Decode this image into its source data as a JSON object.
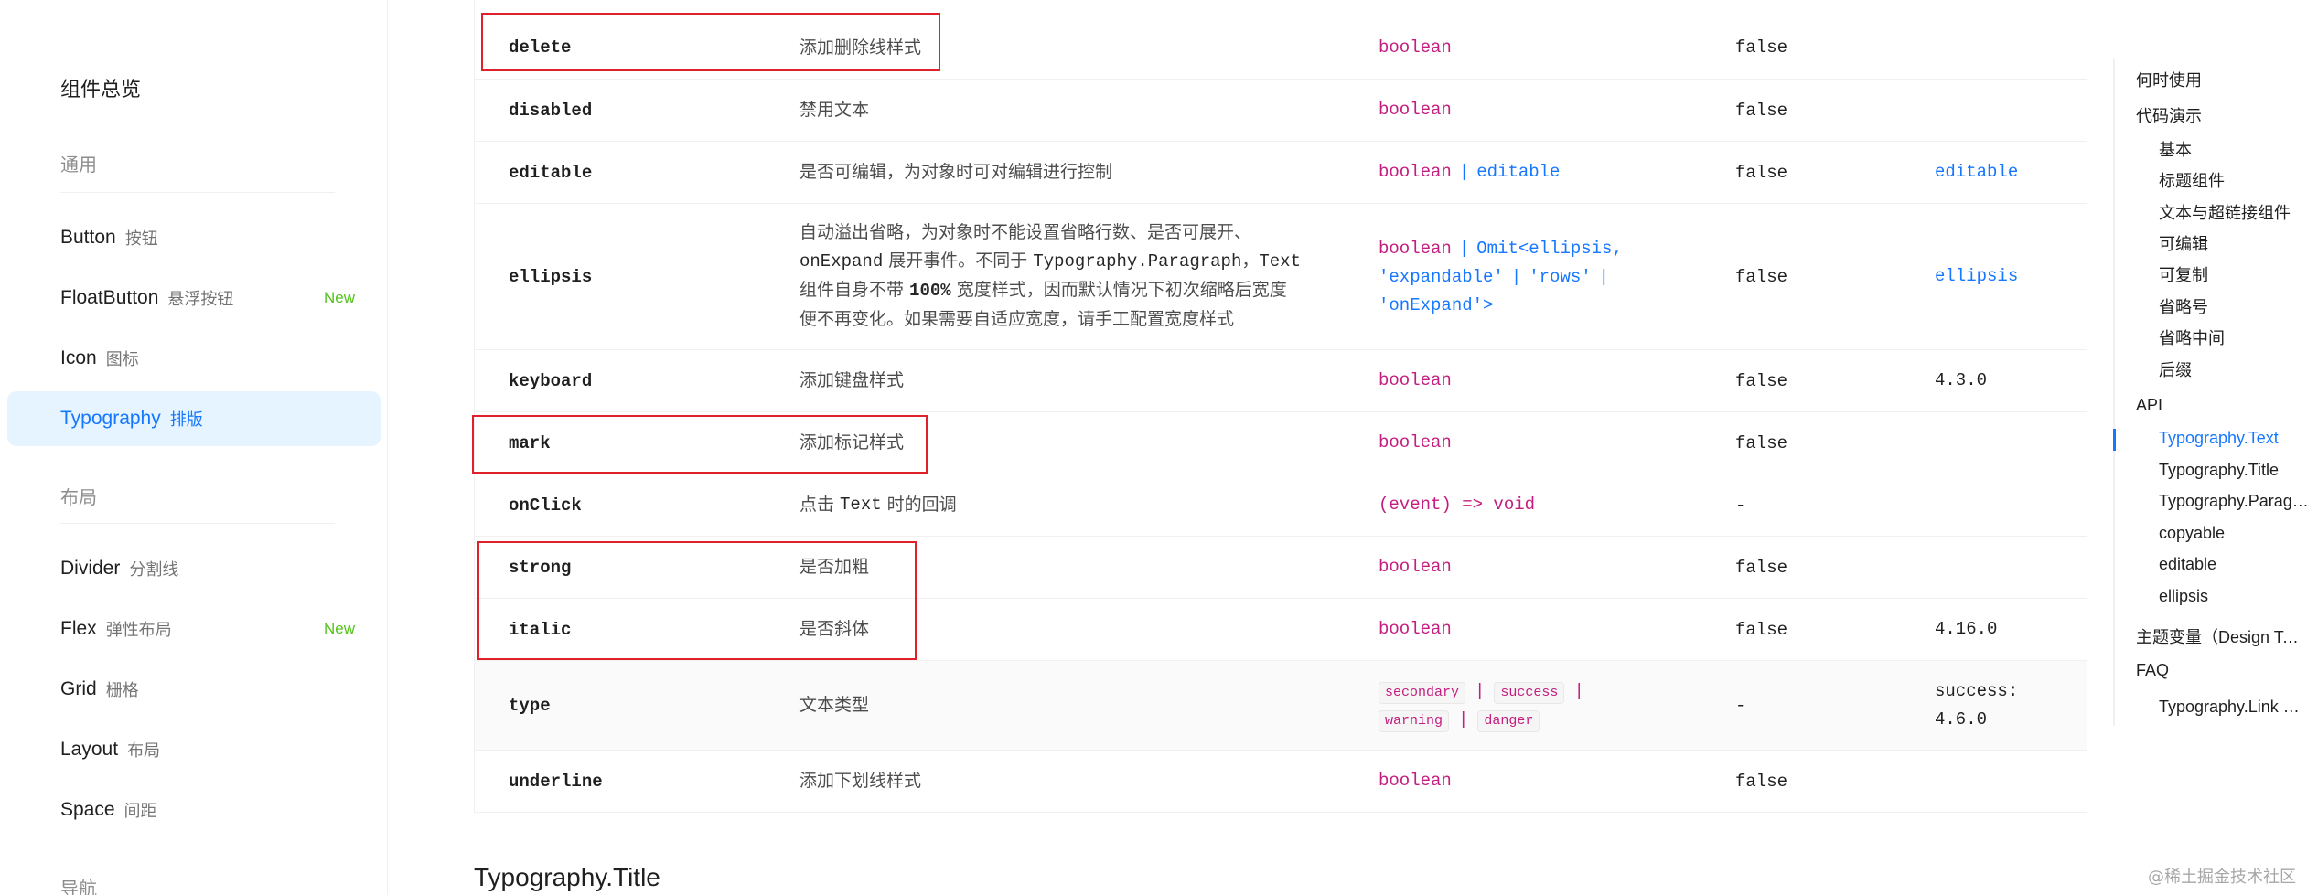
{
  "sidebar": {
    "title": "组件总览",
    "groups": {
      "general": "通用",
      "layout": "布局",
      "nav": "导航"
    },
    "items": [
      {
        "en": "Button",
        "cn": "按钮",
        "badge": ""
      },
      {
        "en": "FloatButton",
        "cn": "悬浮按钮",
        "badge": "New"
      },
      {
        "en": "Icon",
        "cn": "图标",
        "badge": ""
      },
      {
        "en": "Typography",
        "cn": "排版",
        "badge": ""
      },
      {
        "en": "Divider",
        "cn": "分割线",
        "badge": ""
      },
      {
        "en": "Flex",
        "cn": "弹性布局",
        "badge": "New"
      },
      {
        "en": "Grid",
        "cn": "栅格",
        "badge": ""
      },
      {
        "en": "Layout",
        "cn": "布局",
        "badge": ""
      },
      {
        "en": "Space",
        "cn": "间距",
        "badge": ""
      }
    ]
  },
  "table": {
    "rows": {
      "delete": {
        "prop": "delete",
        "desc": "添加删除线样式",
        "type": "boolean",
        "def": "false",
        "ver": ""
      },
      "disabled": {
        "prop": "disabled",
        "desc": "禁用文本",
        "type": "boolean",
        "def": "false",
        "ver": ""
      },
      "editable": {
        "prop": "editable",
        "desc": "是否可编辑，为对象时可对编辑进行控制",
        "type_a": "boolean",
        "type_sep": "|",
        "type_b": "editable",
        "def": "false",
        "ver": "editable"
      },
      "ellipsis": {
        "prop": "ellipsis",
        "desc_1": "自动溢出省略，为对象时不能设置省略行数、是否可展开、",
        "desc_2a": "onExpand",
        "desc_2b": " 展开事件。不同于 ",
        "desc_2c": "Typography.Paragraph",
        "desc_2d": "，",
        "desc_2e": "Text",
        "desc_3a": "组件自身不带 ",
        "desc_3b": "100%",
        "desc_3c": " 宽度样式，因而默认情况下初次缩略后宽度",
        "desc_4": "便不再变化。如果需要自适应宽度，请手工配置宽度样式",
        "type_1a": "boolean",
        "type_1sep": "|",
        "type_1b": "Omit<ellipsis,",
        "type_2a": "'expandable'",
        "type_2sep1": "|",
        "type_2b": "'rows'",
        "type_2sep2": "|",
        "type_3": "'onExpand'>",
        "def": "false",
        "ver": "ellipsis"
      },
      "keyboard": {
        "prop": "keyboard",
        "desc": "添加键盘样式",
        "type": "boolean",
        "def": "false",
        "ver": "4.3.0"
      },
      "mark": {
        "prop": "mark",
        "desc": "添加标记样式",
        "type": "boolean",
        "def": "false",
        "ver": ""
      },
      "onClick": {
        "prop": "onClick",
        "desc_a": "点击 ",
        "desc_b": "Text",
        "desc_c": " 时的回调",
        "type": "(event) => void",
        "def": "-",
        "ver": ""
      },
      "strong": {
        "prop": "strong",
        "desc": "是否加粗",
        "type": "boolean",
        "def": "false",
        "ver": ""
      },
      "italic": {
        "prop": "italic",
        "desc": "是否斜体",
        "type": "boolean",
        "def": "false",
        "ver": "4.16.0"
      },
      "type": {
        "prop": "type",
        "desc": "文本类型",
        "tags": [
          "secondary",
          "success",
          "warning",
          "danger"
        ],
        "sep": "|",
        "def": "-",
        "ver_1": "success:",
        "ver_2": "4.6.0"
      },
      "underline": {
        "prop": "underline",
        "desc": "添加下划线样式",
        "type": "boolean",
        "def": "false",
        "ver": ""
      }
    }
  },
  "section_title": "Typography.Title",
  "anchor": {
    "items": [
      {
        "label": "何时使用",
        "level": 1
      },
      {
        "label": "代码演示",
        "level": 1
      },
      {
        "label": "基本",
        "level": 2
      },
      {
        "label": "标题组件",
        "level": 2
      },
      {
        "label": "文本与超链接组件",
        "level": 2
      },
      {
        "label": "可编辑",
        "level": 2
      },
      {
        "label": "可复制",
        "level": 2
      },
      {
        "label": "省略号",
        "level": 2
      },
      {
        "label": "省略中间",
        "level": 2
      },
      {
        "label": "后缀",
        "level": 2
      },
      {
        "label": "API",
        "level": 1
      },
      {
        "label": "Typography.Text",
        "level": 2
      },
      {
        "label": "Typography.Title",
        "level": 2
      },
      {
        "label": "Typography.Paragraph",
        "level": 2
      },
      {
        "label": "copyable",
        "level": 2
      },
      {
        "label": "editable",
        "level": 2
      },
      {
        "label": "ellipsis",
        "level": 2
      },
      {
        "label": "主题变量（Design Token）",
        "level": 1
      },
      {
        "label": "FAQ",
        "level": 1
      },
      {
        "label": "Typography.Link 如何与 react-router 库集成？",
        "level": 2
      }
    ]
  },
  "watermark": "@稀土掘金技术社区",
  "colors": {
    "accent": "#1677ff",
    "code": "#c41d7f",
    "highlight": "#e0202b",
    "new_badge": "#52c41a"
  }
}
